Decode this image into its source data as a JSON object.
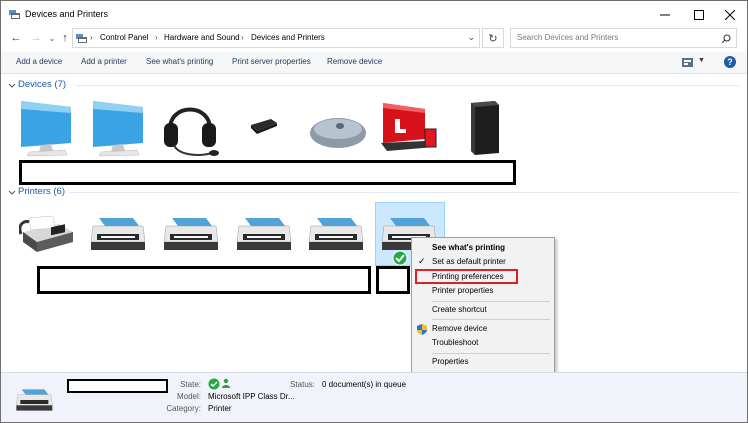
{
  "window": {
    "title": "Devices and Printers"
  },
  "address": {
    "crumbs": [
      "Control Panel",
      "Hardware and Sound",
      "Devices and Printers"
    ],
    "search_placeholder": "Search Devices and Printers"
  },
  "toolbar": {
    "commands": [
      "Add a device",
      "Add a printer",
      "See what's printing",
      "Print server properties",
      "Remove device"
    ]
  },
  "devices": {
    "header": "Devices (7)",
    "items": [
      "monitor",
      "monitor",
      "headset",
      "usb-receiver",
      "mouse",
      "laptop",
      "computer-tower"
    ]
  },
  "printers": {
    "header": "Printers (6)",
    "items": [
      "fax",
      "printer",
      "printer",
      "printer",
      "printer",
      "printer"
    ]
  },
  "context_menu": {
    "items": {
      "see_printing": "See what's printing",
      "set_default": "Set as default printer",
      "printing_prefs": "Printing preferences",
      "printer_props": "Printer properties",
      "create_shortcut": "Create shortcut",
      "remove_device": "Remove device",
      "troubleshoot": "Troubleshoot",
      "properties": "Properties"
    }
  },
  "details": {
    "state_label": "State:",
    "model_label": "Model:",
    "model_value": "Microsoft IPP Class Dr...",
    "category_label": "Category:",
    "category_value": "Printer",
    "status_label": "Status:",
    "status_value": "0 document(s) in queue"
  },
  "colors": {
    "accent_blue": "#1e5aa8",
    "menu_highlight": "#e02020",
    "selection": "#cce8ff"
  }
}
